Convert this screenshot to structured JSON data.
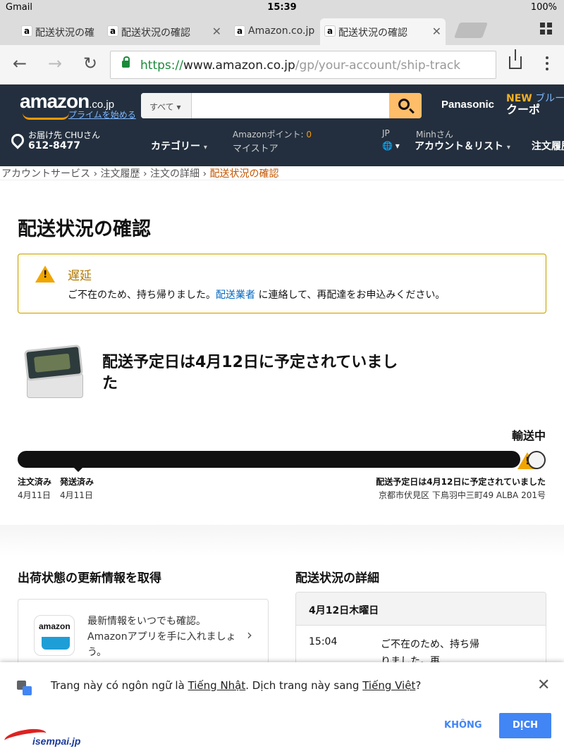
{
  "statusbar": {
    "carrier": "Gmail",
    "time": "15:39",
    "battery": "100%"
  },
  "tabs": [
    {
      "label": "配送状況の確"
    },
    {
      "label": "配送状況の確認"
    },
    {
      "label": "Amazon.co.jp"
    },
    {
      "label": "配送状況の確認"
    }
  ],
  "url": {
    "scheme": "https://",
    "host": "www.amazon.co.jp",
    "path": "/gp/your-account/ship-track"
  },
  "header": {
    "logo": "amazon",
    "logo_suffix": ".co.jp",
    "prime": "プライムを始める",
    "search_category": "すべて",
    "brand": "Panasonic",
    "promo_new": "NEW",
    "promo_text": "ブルーレ",
    "promo_sub": "クーポ"
  },
  "nav": {
    "deliver_to": "お届け先 CHUさん",
    "postal": "612-8477",
    "categories": "カテゴリー",
    "points_label": "Amazonポイント:",
    "points_value": "0",
    "mystore": "マイストア",
    "lang": "JP",
    "greeting": "Minhさん",
    "account": "アカウント＆リスト",
    "orders": "注文履歴"
  },
  "breadcrumb": [
    "アカウントサービス",
    "注文履歴",
    "注文の詳細",
    "配送状況の確認"
  ],
  "page_title": "配送状況の確認",
  "alert": {
    "title": "遅延",
    "msg_before": "ご不在のため、持ち帰りました。",
    "link": "配送業者",
    "msg_after": " に連絡して、再配達をお申込みください。"
  },
  "shipment": {
    "eta_heading": "配送予定日は4月12日に予定されていました",
    "status": "輸送中",
    "progress": 0.95,
    "ordered_label": "注文済み",
    "shipped_label": "発送済み",
    "ordered_date": "4月11日",
    "shipped_date": "4月11日",
    "delivery_note": "配送予定日は4月12日に予定されていました",
    "address": "京都市伏見区 下鳥羽中三町49 ALBA 201号"
  },
  "updates": {
    "heading": "出荷状態の更新情報を取得",
    "app_icon_text": "amazon",
    "app_text": "最新情報をいつでも確認。Amazonアプリを手に入れましょう。"
  },
  "details": {
    "heading": "配送状況の詳細",
    "date": "4月12日木曜日",
    "time": "15:04",
    "event": "ご不在のため、持ち帰りました。再"
  },
  "translate": {
    "msg_a": "Trang này có ngôn ngữ là ",
    "from_lang": "Tiếng Nhật",
    "msg_b": ". Dịch trang này sang ",
    "to_lang": "Tiếng Việt",
    "msg_c": "?",
    "no": "KHÔNG",
    "yes": "DỊCH"
  },
  "watermark": "isempai.jp",
  "colors": {
    "amazon_header": "#232f3e",
    "accent": "#f90",
    "link": "#0066c0",
    "chrome_blue": "#4285f4",
    "alert_border": "#c8a000"
  }
}
